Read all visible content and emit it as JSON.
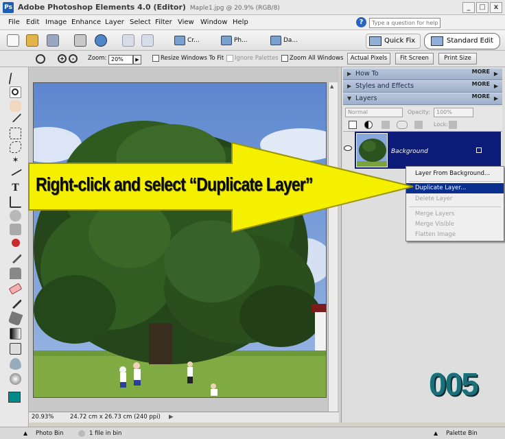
{
  "window": {
    "app_title": "Adobe Photoshop Elements 4.0 (Editor)",
    "document_title": "Maple1.jpg @ 20.9% (RGB/8)",
    "minimize_label": "_",
    "maximize_label": "□",
    "close_label": "x"
  },
  "menu": {
    "items": [
      "File",
      "Edit",
      "Image",
      "Enhance",
      "Layer",
      "Select",
      "Filter",
      "View",
      "Window",
      "Help"
    ],
    "help_icon": "?",
    "help_placeholder": "Type a question for help"
  },
  "shortcuts": {
    "create_label": "Cr...",
    "photomerge_label": "Ph...",
    "date_view_label": "Da...",
    "quick_fix_label": "Quick Fix",
    "standard_edit_label": "Standard Edit"
  },
  "options": {
    "zoom_label": "Zoom:",
    "zoom_value": "20%",
    "resize_windows_label": "Resize Windows To Fit",
    "ignore_palettes_label": "Ignore Palettes",
    "zoom_all_windows_label": "Zoom All Windows",
    "actual_pixels_label": "Actual Pixels",
    "fit_screen_label": "Fit Screen",
    "print_size_label": "Print Size"
  },
  "palettes": {
    "how_to": "How To",
    "styles_effects": "Styles and Effects",
    "layers": "Layers",
    "more_label": "MORE"
  },
  "layers_panel": {
    "blend_mode": "Normal",
    "opacity_label": "Opacity:",
    "opacity_value": "100%",
    "lock_label": "Lock:",
    "layer_name": "Background"
  },
  "context_menu": {
    "items": [
      {
        "label": "Layer From Background...",
        "state": "normal"
      },
      {
        "label": "Duplicate Layer...",
        "state": "highlighted"
      },
      {
        "label": "Delete Layer",
        "state": "disabled"
      },
      {
        "label": "Merge Layers",
        "state": "disabled"
      },
      {
        "label": "Merge Visible",
        "state": "disabled"
      },
      {
        "label": "Flatten Image",
        "state": "disabled"
      }
    ]
  },
  "status": {
    "zoom": "20.93%",
    "doc_info": "24.72 cm x 26.73 cm (240 ppi)"
  },
  "bins": {
    "photo_bin": "Photo Bin",
    "files_in_bin": "1 file in bin",
    "palette_bin": "Palette Bin"
  },
  "overlay": {
    "instruction": "Right-click and select “Duplicate Layer”",
    "step_number": "005"
  },
  "colors": {
    "highlight": "#0a2f8e",
    "layer_selected": "#0c1c78",
    "arrow_fill": "#f5f000",
    "foreground_swatch": "#008a8a",
    "background_swatch": "#000000",
    "step_number_color": "#1a6f78"
  }
}
